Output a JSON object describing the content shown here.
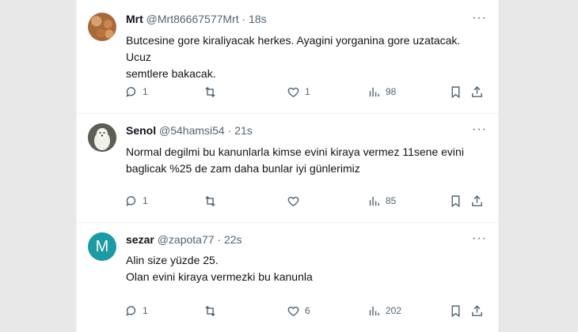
{
  "tweets": [
    {
      "name": "Mrt",
      "handle": "@Mrt86667577Mrt",
      "time": "18s",
      "text_lines": [
        "Butcesine gore kiraliyacak herkes. Ayagini yorganina gore uzatacak. Ucuz",
        "semtlere bakacak."
      ],
      "replies": "1",
      "retweets": "",
      "likes": "1",
      "views": "98"
    },
    {
      "name": "Senol",
      "handle": "@54hamsi54",
      "time": "21s",
      "text_lines": [
        "Normal degilmi bu kanunlarla kimse evini kiraya vermez 11sene evini",
        "baglicak %25 de zam daha bunlar iyi günlerimiz"
      ],
      "replies": "1",
      "retweets": "",
      "likes": "",
      "views": "85"
    },
    {
      "name": "sezar",
      "handle": "@zapota77",
      "time": "22s",
      "avatar_letter": "M",
      "text_lines": [
        "Alin size yüzde 25.",
        "Olan evini kiraya vermezki bu kanunla"
      ],
      "replies": "1",
      "retweets": "",
      "likes": "6",
      "views": "202"
    }
  ],
  "separator": "·",
  "more_label": "···",
  "icons": [
    "reply-icon",
    "retweet-icon",
    "like-icon",
    "views-icon",
    "bookmark-icon",
    "share-icon"
  ],
  "colors": {
    "text": "#0f1419",
    "secondary": "#536471",
    "avatar_m": "#1d9aa3"
  }
}
